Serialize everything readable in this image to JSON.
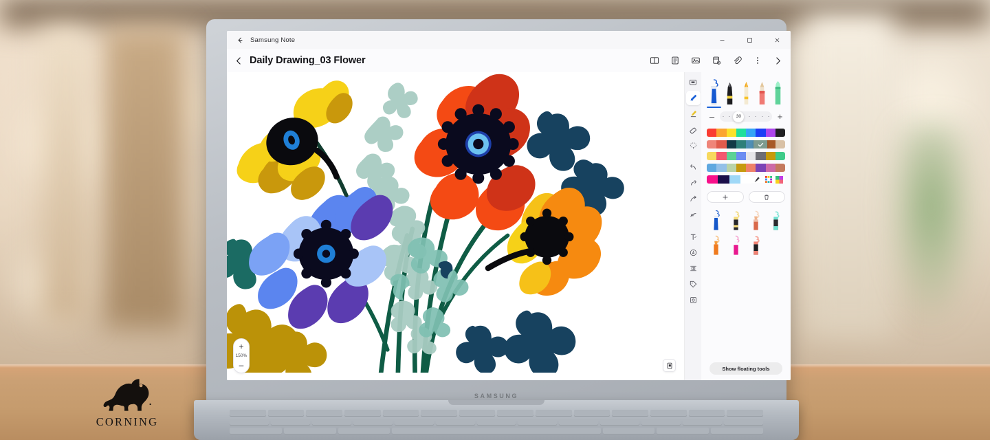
{
  "window": {
    "app_name": "Samsung Note",
    "back_icon": "arrow-left-icon",
    "minimize_label": "–",
    "maximize_label": "□",
    "close_label": "✕"
  },
  "header": {
    "back_icon": "chevron-left-icon",
    "title": "Daily Drawing_03 Flower",
    "icons": [
      {
        "name": "book-view-icon"
      },
      {
        "name": "list-view-icon"
      },
      {
        "name": "image-icon"
      },
      {
        "name": "add-page-icon"
      },
      {
        "name": "attachment-icon"
      },
      {
        "name": "more-options-icon"
      },
      {
        "name": "chevron-right-icon"
      }
    ]
  },
  "canvas": {
    "zoom_in_label": "+",
    "zoom_level": "150%",
    "zoom_out_label": "–",
    "page_icon": "page-duplicate-icon",
    "artwork_title": "Flower bouquet illustration"
  },
  "rail": {
    "items": [
      {
        "name": "comment-tool",
        "selected": false
      },
      {
        "name": "pen-tool",
        "selected": true
      },
      {
        "name": "highlighter-tool",
        "selected": false
      },
      {
        "name": "eraser-tool",
        "selected": false
      },
      {
        "name": "lasso-select-tool",
        "selected": false
      },
      {
        "name": "undo-button",
        "selected": false
      },
      {
        "name": "redo-button",
        "selected": false
      },
      {
        "name": "export-tool",
        "selected": false
      },
      {
        "name": "convert-tool",
        "selected": false
      },
      {
        "name": "text-tool",
        "selected": false
      },
      {
        "name": "letter-recognition-tool",
        "selected": false
      },
      {
        "name": "table-tool",
        "selected": false
      },
      {
        "name": "tag-tool",
        "selected": false
      },
      {
        "name": "scan-tool",
        "selected": false
      }
    ]
  },
  "panel": {
    "pens": [
      {
        "name": "fountain-pen",
        "body": "#1659d1",
        "tip": "#ffffff",
        "active": true
      },
      {
        "name": "calligraphy-pen",
        "body": "#1c1c1f",
        "tip": "#f2d23a",
        "active": false
      },
      {
        "name": "pencil",
        "body": "#f6c32a",
        "tip": "#f0e3c2",
        "active": false
      },
      {
        "name": "marker",
        "body": "#f07a74",
        "tip": "#d9b08a",
        "active": false
      },
      {
        "name": "brush",
        "body": "#5fd39a",
        "tip": "#bdf0d8",
        "active": false
      }
    ],
    "size": {
      "decrease_label": "–",
      "value": "30",
      "increase_label": "+"
    },
    "palette_rows": [
      [
        "#fa3c32",
        "#fba531",
        "#fbe12c",
        "#20de9c",
        "#35a4f5",
        "#1c3ef5",
        "#ad45ec",
        "#1f1f22"
      ],
      [
        "#ef8579",
        "#e05b4c",
        "#123a47",
        "#2e7f7a",
        "#4f8fb5",
        "#7d9b8f",
        "#a85a28",
        "#d9c1a6"
      ],
      [
        "#f7d95e",
        "#f2586f",
        "#5bd295",
        "#6b8df2",
        "#e7e7e9",
        "#6e6e74",
        "#c79a0a",
        "#3ecb8a"
      ],
      [
        "#5fa8e0",
        "#93c0e8",
        "#b9d3a8",
        "#c69a10",
        "#ef8169",
        "#7b43b6",
        "#cd6aa7",
        "#c4795e"
      ],
      [
        "#f7108a",
        "#1c0f4a",
        "#9fd8f7",
        "#ffffff",
        "#ffffff",
        "#ffffff",
        "#ffffff",
        "#ffffff"
      ]
    ],
    "selected_swatch": {
      "row": 1,
      "index": 5,
      "color": "#7d9b8f"
    },
    "palette_tools": [
      {
        "name": "eyedropper-icon"
      },
      {
        "name": "color-grid-icon"
      },
      {
        "name": "color-spectrum-icon"
      }
    ],
    "actions": {
      "add_label": "+",
      "add_name": "add-favorite-button",
      "delete_name": "delete-favorite-button"
    },
    "favorites": [
      {
        "name": "fav-pen-blue",
        "body": "#1557c9",
        "tip": "#ffffff",
        "cap": "#e9eef7"
      },
      {
        "name": "fav-pen-yellow",
        "body": "#27272b",
        "tip": "#f6dc7a",
        "cap": "#f2d97a"
      },
      {
        "name": "fav-pen-peach",
        "body": "#d9694a",
        "tip": "#f0b48c",
        "cap": "#f6d6bd"
      },
      {
        "name": "fav-pen-mint",
        "body": "#2a2a2e",
        "tip": "#6fe0d0",
        "cap": "#86e6d8"
      },
      {
        "name": "fav-pen-orange",
        "body": "#ef7a1e",
        "tip": "#f59c3c",
        "cap": "#f8c68c"
      },
      {
        "name": "fav-pen-magenta",
        "body": "#e8188f",
        "tip": "#ffffff",
        "cap": "#f5a8d2"
      },
      {
        "name": "fav-pen-salmon",
        "body": "#1f1f22",
        "tip": "#f08274",
        "cap": "#f6a79b"
      }
    ],
    "floating_tools_label": "Show floating tools"
  },
  "laptop": {
    "brand": "SAMSUNG"
  },
  "branding": {
    "logo_name": "corning-gorilla-logo",
    "wordmark": "CORNING"
  }
}
